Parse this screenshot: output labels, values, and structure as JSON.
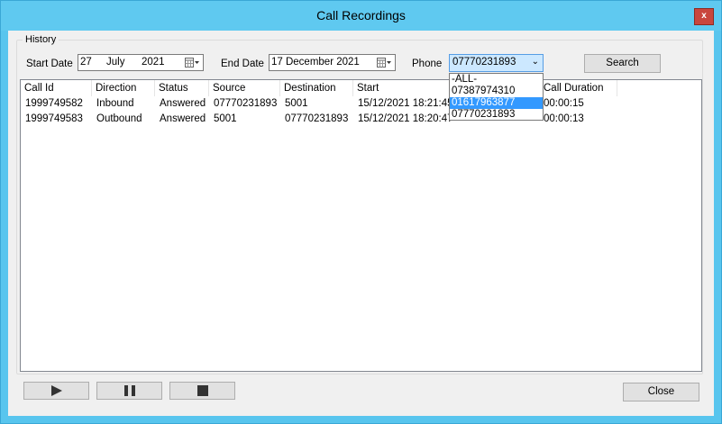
{
  "window": {
    "title": "Call Recordings",
    "close_label": "x"
  },
  "history": {
    "group_label": "History",
    "start_date_label": "Start Date",
    "start_day": "27",
    "start_month": "July",
    "start_year": "2021",
    "end_date_label": "End Date",
    "end_date": "17 December 2021",
    "phone_label": "Phone",
    "phone_value": "07770231893",
    "search_label": "Search",
    "phone_options": [
      "-ALL-",
      "07387974310",
      "01617963877",
      "07770231893"
    ],
    "highlighted_option_index": 2
  },
  "table": {
    "columns": [
      "Call Id",
      "Direction",
      "Status",
      "Source",
      "Destination",
      "Start",
      "Call Duration"
    ],
    "rows": [
      [
        "1999749582",
        "Inbound",
        "Answered",
        "07770231893",
        "5001",
        "15/12/2021 18:21:45",
        "00:00:15"
      ],
      [
        "1999749583",
        "Outbound",
        "Answered",
        "5001",
        "07770231893",
        "15/12/2021 18:20:47",
        "00:00:13"
      ]
    ]
  },
  "controls": {
    "play_icon": "play-icon",
    "pause_icon": "pause-icon",
    "stop_icon": "stop-icon",
    "close_label": "Close"
  },
  "colors": {
    "titlebar": "#5fc9f0",
    "selection": "#3399ff",
    "close_button": "#c9463d"
  }
}
